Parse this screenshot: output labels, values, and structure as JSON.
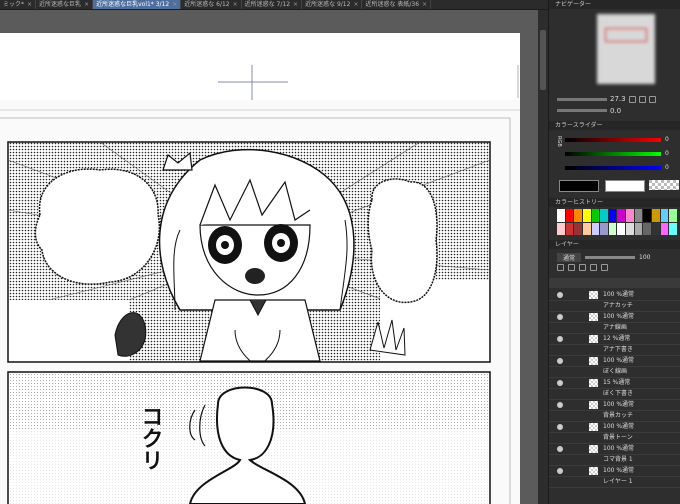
{
  "tabs": [
    {
      "label": "ミック*",
      "active": false
    },
    {
      "label": "近所迷惑な巨乳",
      "active": false
    },
    {
      "label": "近所迷惑な巨乳vol1* 3/12",
      "active": true
    },
    {
      "label": "近所迷惑な 6/12",
      "active": false
    },
    {
      "label": "近所迷惑な 7/12",
      "active": false
    },
    {
      "label": "近所迷惑な 9/12",
      "active": false
    },
    {
      "label": "近所迷惑な 表紙/36",
      "active": false
    }
  ],
  "navigator": {
    "title": "ナビゲーター",
    "zoom": "27.3",
    "angle": "0.0"
  },
  "color_slider": {
    "title": "カラースライダー",
    "mode": "RGB",
    "r": "0",
    "g": "0",
    "b": "0"
  },
  "color_history": {
    "title": "カラーヒストリー"
  },
  "layers": {
    "title": "レイヤー",
    "blend_mode": "通常",
    "opacity": "100",
    "rows": [
      {
        "opacity": "100 %通常",
        "name": "アナカッチ"
      },
      {
        "opacity": "100 %通常",
        "name": "アナ線画"
      },
      {
        "opacity": "12 %通常",
        "name": "アナ下書き"
      },
      {
        "opacity": "100 %通常",
        "name": "ぼく線画"
      },
      {
        "opacity": "15 %通常",
        "name": "ぼく下書き"
      },
      {
        "opacity": "100 %通常",
        "name": "背景カッチ"
      },
      {
        "opacity": "100 %通常",
        "name": "背景トーン"
      },
      {
        "opacity": "100 %通常",
        "name": "コマ背景 1"
      },
      {
        "opacity": "100 %通常",
        "name": "レイヤー 1"
      }
    ]
  },
  "manga": {
    "sfx": "コクリ"
  },
  "accent": "#4d6e9e"
}
